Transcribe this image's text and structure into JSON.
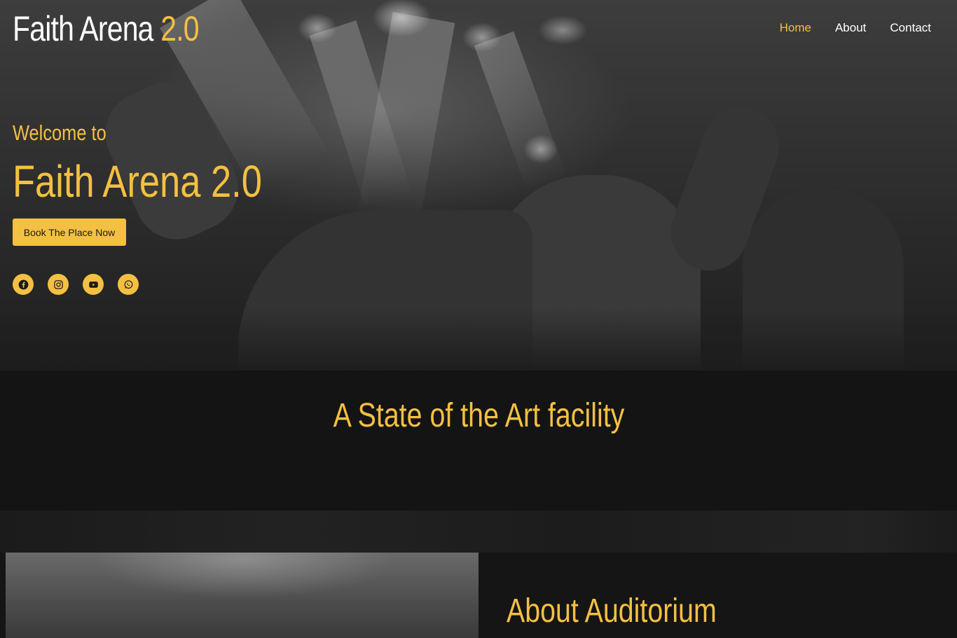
{
  "brand": {
    "name_main": "Faith Arena",
    "name_accent": "2.0"
  },
  "nav": [
    {
      "label": "Home",
      "active": true
    },
    {
      "label": "About",
      "active": false
    },
    {
      "label": "Contact",
      "active": false
    }
  ],
  "hero": {
    "welcome": "Welcome to",
    "title": "Faith Arena 2.0",
    "cta_label": "Book The Place Now"
  },
  "socials": [
    {
      "icon": "facebook-icon"
    },
    {
      "icon": "instagram-icon"
    },
    {
      "icon": "youtube-icon"
    },
    {
      "icon": "whatsapp-icon"
    }
  ],
  "facility": {
    "title": "A State of the Art facility"
  },
  "about": {
    "title": "About Auditorium"
  },
  "colors": {
    "accent": "#f4c042",
    "background": "#141414",
    "text": "#ffffff"
  }
}
